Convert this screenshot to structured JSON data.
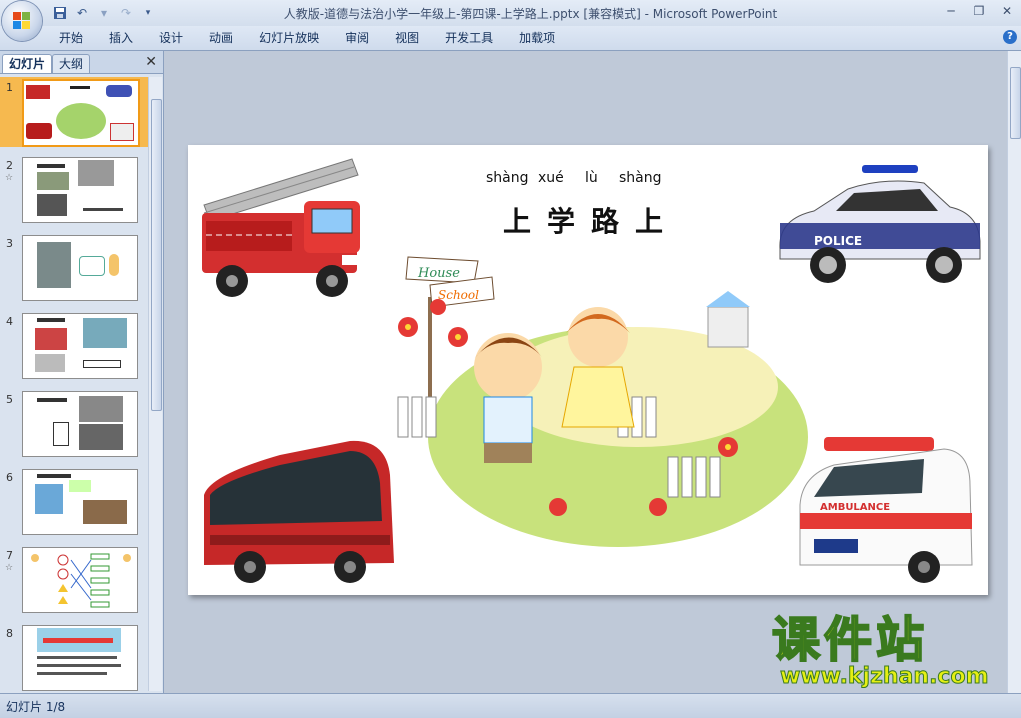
{
  "window": {
    "title": "人教版-道德与法治小学一年级上-第四课-上学路上.pptx [兼容模式] - Microsoft PowerPoint"
  },
  "menu": {
    "tabs": [
      "开始",
      "插入",
      "设计",
      "动画",
      "幻灯片放映",
      "审阅",
      "视图",
      "开发工具",
      "加载项"
    ]
  },
  "panel": {
    "tab_slides": "幻灯片",
    "tab_outline": "大纲",
    "close": "✕",
    "thumbnails": [
      {
        "num": "1",
        "anim": ""
      },
      {
        "num": "2",
        "anim": "☆"
      },
      {
        "num": "3",
        "anim": ""
      },
      {
        "num": "4",
        "anim": ""
      },
      {
        "num": "5",
        "anim": ""
      },
      {
        "num": "6",
        "anim": ""
      },
      {
        "num": "7",
        "anim": "☆"
      },
      {
        "num": "8",
        "anim": ""
      }
    ]
  },
  "slide": {
    "pinyin": [
      "shàng",
      "xué",
      "lù",
      "shàng"
    ],
    "title": "上学路上",
    "sign_house": "House",
    "sign_school": "School",
    "police_label": "POLICE",
    "ambulance_label": "AMBULANCE"
  },
  "status": {
    "slide_counter": "幻灯片 1/8"
  },
  "watermark": {
    "brand": "课件站",
    "url": "www.kjzhan.com"
  },
  "icons": [
    "office-button-icon",
    "save-icon",
    "undo-icon",
    "redo-icon",
    "customize-icon",
    "minimize-icon",
    "help-icon"
  ],
  "colors": {
    "selected_thumb": "#f6b94f",
    "accent": "#2a6fc9",
    "watermark": "#e5ef14"
  }
}
